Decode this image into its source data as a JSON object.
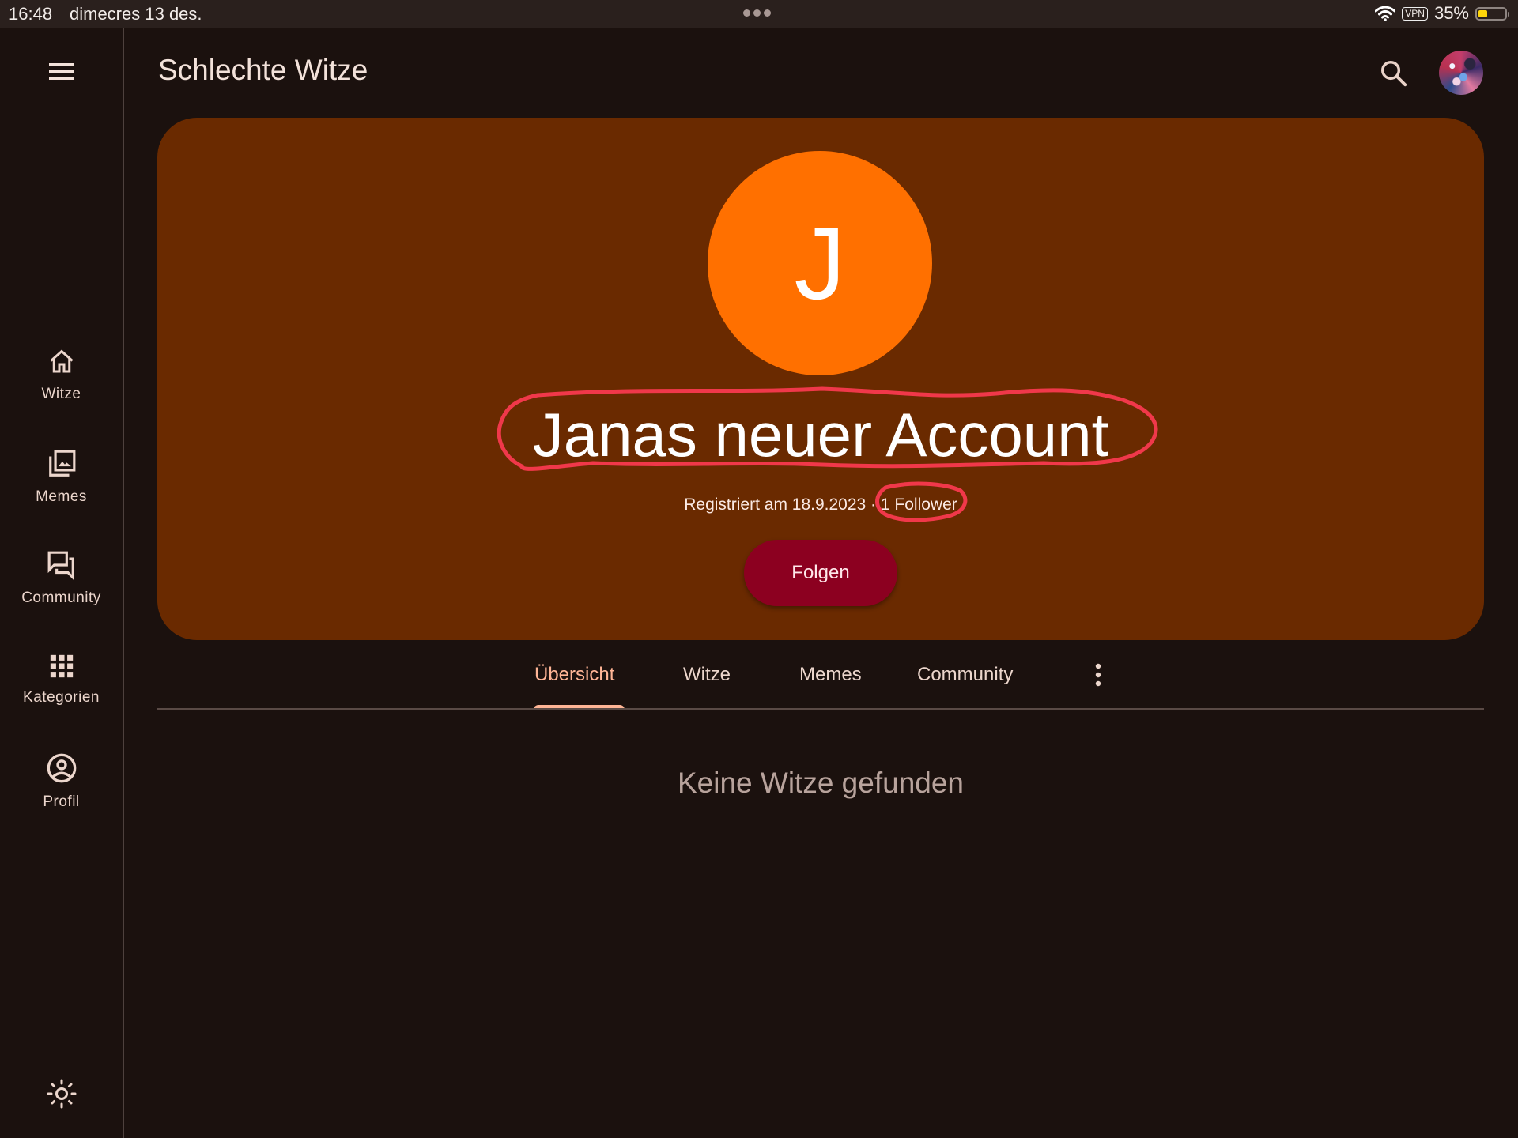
{
  "status_bar": {
    "time": "16:48",
    "date": "dimecres 13 des.",
    "vpn_label": "VPN",
    "battery_percent_label": "35%",
    "battery_level": 0.35,
    "icons": [
      "wifi-icon",
      "vpn-icon",
      "battery-icon",
      "multitasking-dots-icon"
    ]
  },
  "header": {
    "title": "Schlechte Witze",
    "menu_icon": "hamburger-menu-icon",
    "search_icon": "search-icon",
    "avatar_icon": "user-avatar"
  },
  "sidebar": {
    "items": [
      {
        "label": "Witze",
        "icon": "home-icon"
      },
      {
        "label": "Memes",
        "icon": "photo-library-icon"
      },
      {
        "label": "Community",
        "icon": "forum-icon"
      },
      {
        "label": "Kategorien",
        "icon": "apps-grid-icon"
      },
      {
        "label": "Profil",
        "icon": "account-circle-icon"
      }
    ],
    "theme_toggle_icon": "sun-icon"
  },
  "profile": {
    "avatar_letter": "J",
    "name": "Janas neuer Account",
    "registered": "Registriert am 18.9.2023",
    "separator": "·",
    "followers": "1 Follower",
    "follow_button": "Folgen"
  },
  "tabs": {
    "items": [
      {
        "label": "Übersicht",
        "active": true
      },
      {
        "label": "Witze",
        "active": false
      },
      {
        "label": "Memes",
        "active": false
      },
      {
        "label": "Community",
        "active": false
      }
    ],
    "more_icon": "more-vert-icon"
  },
  "content": {
    "empty_message": "Keine Witze gefunden"
  },
  "colors": {
    "background": "#1b110e",
    "banner": "#6a2a00",
    "avatar": "#ff7000",
    "follow_button": "#8c0020",
    "active_tab": "#ffb596",
    "annotation": "#f0384a"
  }
}
